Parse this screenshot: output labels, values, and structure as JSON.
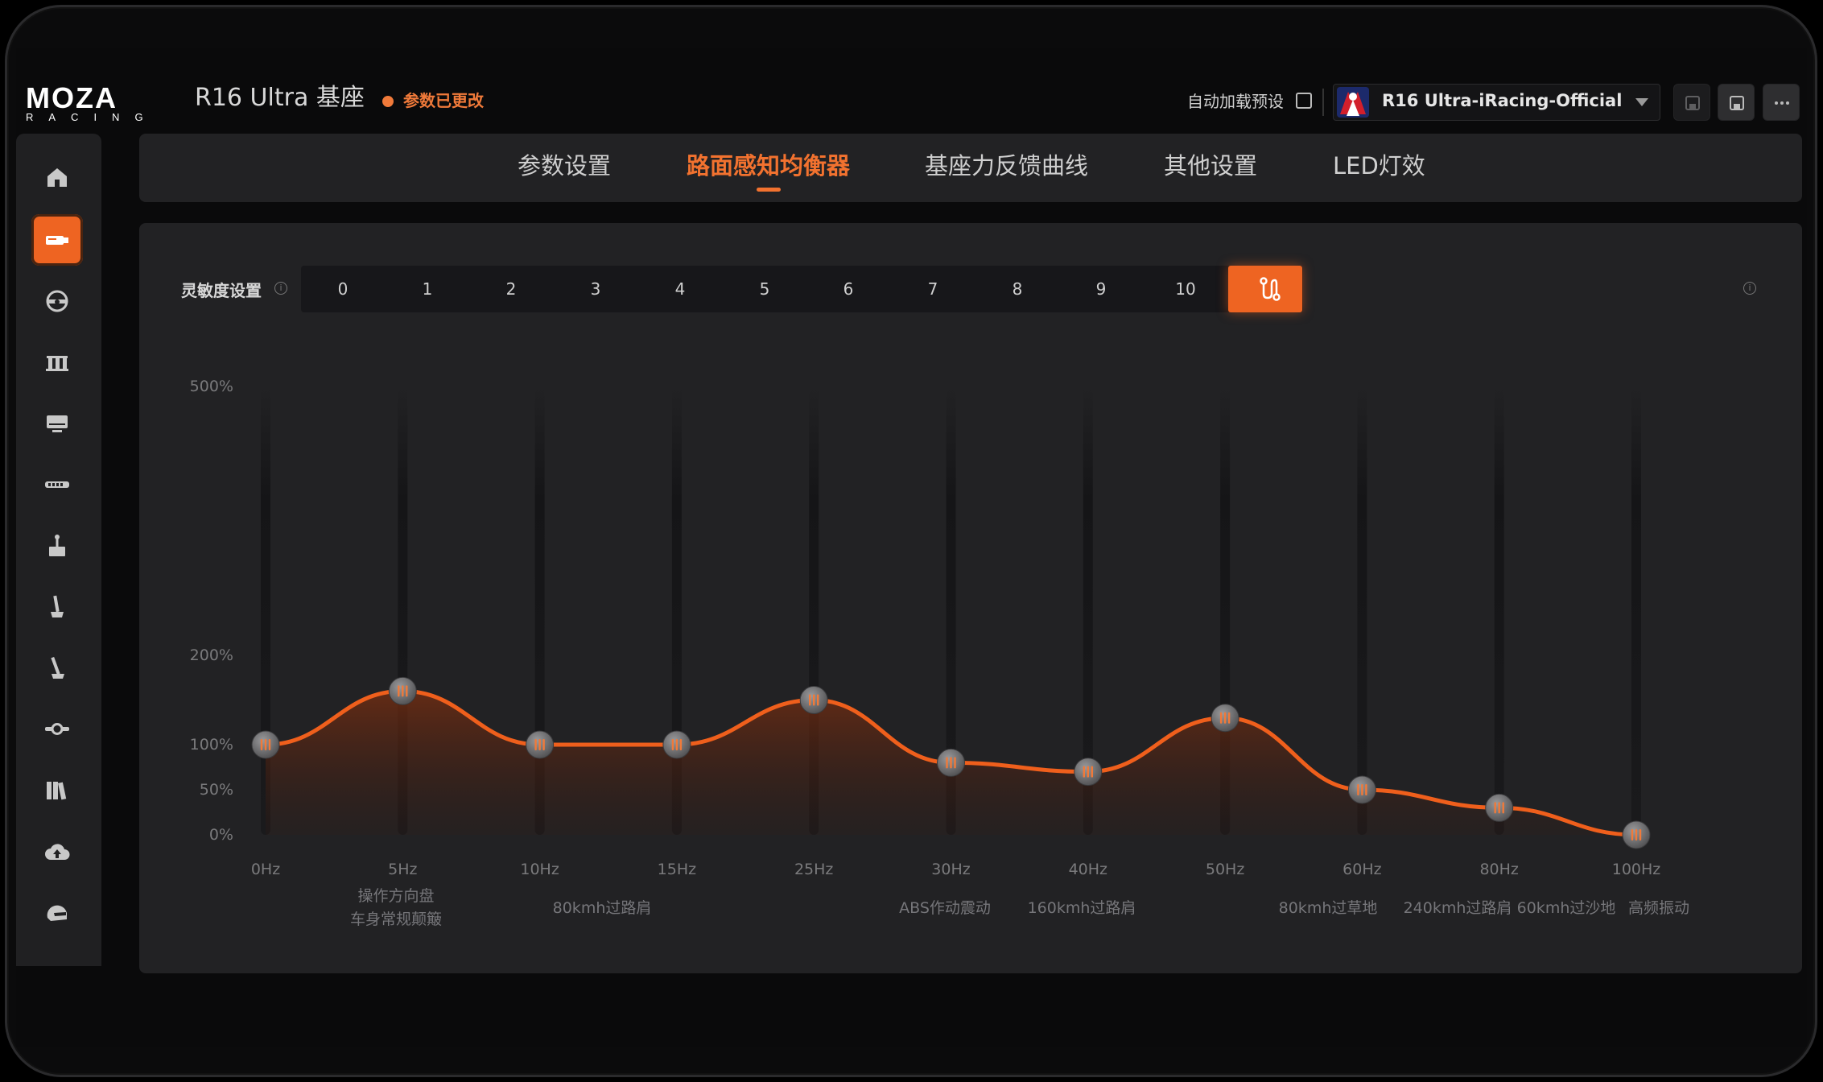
{
  "header": {
    "logo_main": "MOZA",
    "logo_sub": "RACING",
    "device_title": "R16 Ultra 基座",
    "changed_label": "参数已更改",
    "autoload_label": "自动加载预设",
    "preset_name": "R16 Ultra-iRacing-Official"
  },
  "sidebar": {
    "items": [
      {
        "icon": "home-icon"
      },
      {
        "icon": "wheelbase-icon",
        "active": true
      },
      {
        "icon": "steering-wheel-icon"
      },
      {
        "icon": "pedals-icon"
      },
      {
        "icon": "dashboard-icon"
      },
      {
        "icon": "led-bar-icon"
      },
      {
        "icon": "handbrake-icon"
      },
      {
        "icon": "shifter-icon"
      },
      {
        "icon": "sequential-shifter-icon"
      },
      {
        "icon": "hub-icon"
      },
      {
        "icon": "library-icon"
      },
      {
        "icon": "cloud-upload-icon"
      },
      {
        "icon": "helmet-icon"
      }
    ]
  },
  "tabs": [
    {
      "label": "参数设置"
    },
    {
      "label": "路面感知均衡器",
      "active": true
    },
    {
      "label": "基座力反馈曲线"
    },
    {
      "label": "其他设置"
    },
    {
      "label": "LED灯效"
    }
  ],
  "sensitivity": {
    "label": "灵敏度设置",
    "options": [
      "0",
      "1",
      "2",
      "3",
      "4",
      "5",
      "6",
      "7",
      "8",
      "9",
      "10"
    ],
    "active_icon": "custom-curve-icon"
  },
  "chart_data": {
    "type": "line",
    "x": [
      "0Hz",
      "5Hz",
      "10Hz",
      "15Hz",
      "25Hz",
      "30Hz",
      "40Hz",
      "50Hz",
      "60Hz",
      "80Hz",
      "100Hz"
    ],
    "values": [
      100,
      160,
      100,
      100,
      150,
      80,
      70,
      130,
      50,
      30,
      0
    ],
    "yticks": [
      "500%",
      "200%",
      "100%",
      "50%",
      "0%"
    ],
    "ytick_values": [
      500,
      200,
      100,
      50,
      0
    ],
    "annotations": [
      {
        "at": "5Hz",
        "text": "操作方向盘"
      },
      {
        "at": "5Hz",
        "text": "车身常规颠簸"
      },
      {
        "at": "10Hz",
        "text": "80kmh过路肩"
      },
      {
        "at": "30Hz",
        "text": "ABS作动震动"
      },
      {
        "at": "40Hz",
        "text": "160kmh过路肩"
      },
      {
        "at": "60Hz",
        "text": "80kmh过草地"
      },
      {
        "at": "80Hz",
        "text": "240kmh过路肩"
      },
      {
        "at": "80Hz",
        "text": "60kmh过沙地"
      },
      {
        "at": "100Hz",
        "text": "高频振动"
      }
    ],
    "line_color": "#ef5f1c"
  }
}
